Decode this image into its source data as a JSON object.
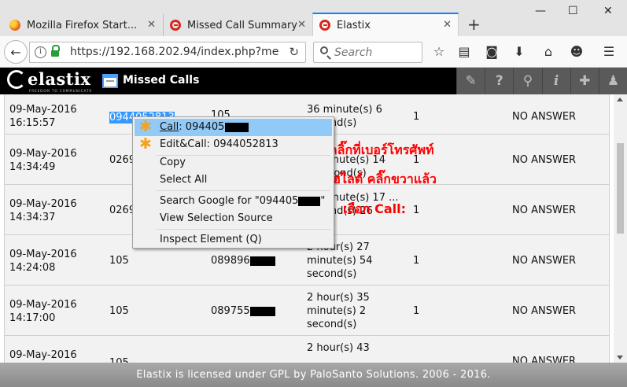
{
  "browser": {
    "tabs": [
      {
        "title": "Mozilla Firefox Start..."
      },
      {
        "title": "Missed Call Summary"
      },
      {
        "title": "Elastix"
      }
    ],
    "url": "https://192.168.202.94/index.php?me",
    "search_placeholder": "Search"
  },
  "app": {
    "logo": "elastix",
    "logo_tagline": "FREEDOM TO COMMUNICATE",
    "module_title": "Missed Calls",
    "footer": "Elastix is licensed under GPL by PaloSanto Solutions. 2006 - 2016."
  },
  "rows": [
    {
      "date": "09-May-2016 16:15:57",
      "src_visible": "0944052813",
      "dst": "105",
      "duration": "36 minute(s) 6 second(s)",
      "count": "1",
      "status": "NO ANSWER"
    },
    {
      "date": "09-May-2016 14:34:49",
      "src": "0269",
      "duration": "... minute(s) 14 ...second(s)",
      "count": "1",
      "status": "NO ANSWER"
    },
    {
      "date": "09-May-2016 14:34:37",
      "src": "0269",
      "duration": "... minute(s) 17 ... second(s) 26",
      "count": "1",
      "status": "NO ANSWER"
    },
    {
      "date": "09-May-2016 14:24:08",
      "src": "105",
      "dst": "089896",
      "duration": "2 hour(s) 27 minute(s) 54 second(s)",
      "count": "1",
      "status": "NO ANSWER"
    },
    {
      "date": "09-May-2016 14:17:00",
      "src": "105",
      "dst": "089755",
      "duration": "2 hour(s) 35 minute(s) 2 second(s)",
      "count": "1",
      "status": "NO ANSWER"
    },
    {
      "date": "09-May-2016",
      "src": "105",
      "duration": "2 hour(s) 43",
      "count": "",
      "status": "NO ANSWER"
    }
  ],
  "context_menu": {
    "items": [
      {
        "label_prefix": "Call",
        "label_rest": ": 094405"
      },
      {
        "label_prefix": "Edit&Call",
        "label_rest": ": 0944052813"
      },
      {
        "label": "Copy"
      },
      {
        "label": "Select All"
      },
      {
        "label": "Search Google for \"094405",
        "label_suffix": "\""
      },
      {
        "label": "View Selection Source"
      },
      {
        "label": "Inspect Element (Q)"
      }
    ]
  },
  "annotations": {
    "line1": "ดับเบิลคลิ๊กที่เบอร์โทรศัพท์",
    "line2": "เพื่อทำไฮไลต์ คลิ๊กขวาแล้ว",
    "line3": "เลือก Call:"
  },
  "colors": {
    "header_bg": "#000000",
    "selection": "#3399ff",
    "menu_highlight": "#91c9f7",
    "annotation": "#ff0000",
    "star": "#f4a21a"
  }
}
